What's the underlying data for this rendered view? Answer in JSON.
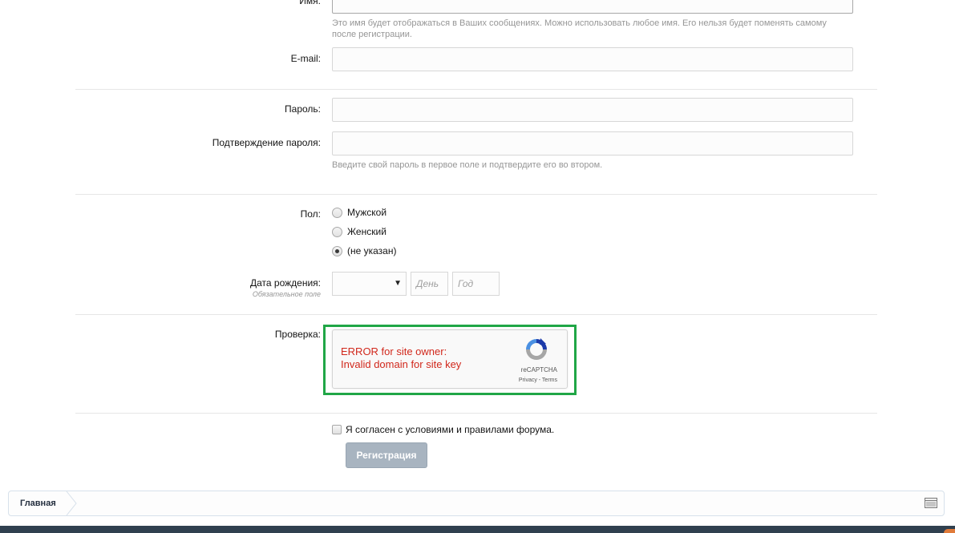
{
  "form": {
    "name_label": "Имя:",
    "name_hint": "Это имя будет отображаться в Ваших сообщениях. Можно использовать любое имя. Его нельзя будет поменять самому после регистрации.",
    "email_label": "E-mail:",
    "password_label": "Пароль:",
    "confirm_label": "Подтверждение пароля:",
    "password_hint": "Введите свой пароль в первое поле и подтвердите его во втором.",
    "gender_label": "Пол:",
    "gender_options": [
      {
        "label": "Мужской",
        "checked": false
      },
      {
        "label": "Женский",
        "checked": false
      },
      {
        "label": "(не указан)",
        "checked": true
      }
    ],
    "birthdate_label": "Дата рождения:",
    "birthdate_required": "Обязательное поле",
    "month_value": "",
    "day_placeholder": "День",
    "year_placeholder": "Год",
    "captcha_label": "Проверка:",
    "agree_label": "Я согласен с условиями и правилами форума.",
    "submit_label": "Регистрация"
  },
  "captcha": {
    "error_line1": "ERROR for site owner:",
    "error_line2": "Invalid domain for site key",
    "brand": "reCAPTCHA",
    "links": "Privacy - Terms",
    "icon": "recaptcha-logo-icon",
    "highlight_color": "#20a646",
    "error_color": "#d1281c"
  },
  "breadcrumb": {
    "home": "Главная",
    "icon": "sitemap-icon"
  },
  "colors": {
    "submit_bg": "#a8b4c0",
    "footer_bg": "#30404f"
  }
}
